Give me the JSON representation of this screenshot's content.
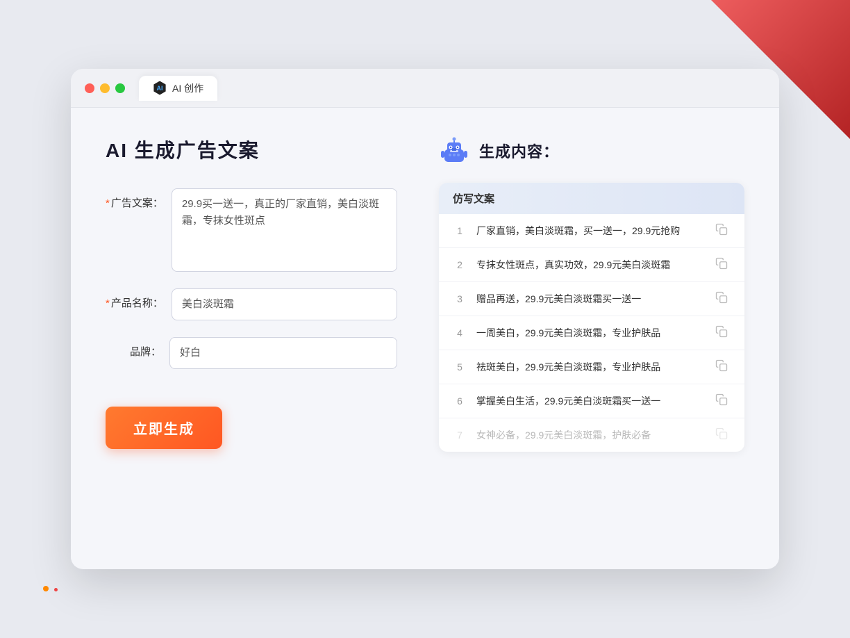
{
  "window": {
    "tab_label": "AI 创作",
    "tab_icon_text": "AI"
  },
  "page": {
    "title": "AI 生成广告文案",
    "result_title": "生成内容："
  },
  "form": {
    "ad_copy_label": "广告文案：",
    "ad_copy_required": "*",
    "ad_copy_value": "29.9买一送一，真正的厂家直销，美白淡斑霜，专抹女性斑点",
    "product_name_label": "产品名称：",
    "product_name_required": "*",
    "product_name_value": "美白淡斑霜",
    "brand_label": "品牌：",
    "brand_value": "好白",
    "generate_button": "立即生成"
  },
  "results": {
    "column_header": "仿写文案",
    "items": [
      {
        "num": 1,
        "text": "厂家直销，美白淡斑霜，买一送一，29.9元抢购"
      },
      {
        "num": 2,
        "text": "专抹女性斑点，真实功效，29.9元美白淡斑霜"
      },
      {
        "num": 3,
        "text": "赠品再送，29.9元美白淡斑霜买一送一"
      },
      {
        "num": 4,
        "text": "一周美白，29.9元美白淡斑霜，专业护肤品"
      },
      {
        "num": 5,
        "text": "祛斑美白，29.9元美白淡斑霜，专业护肤品"
      },
      {
        "num": 6,
        "text": "掌握美白生活，29.9元美白淡斑霜买一送一"
      },
      {
        "num": 7,
        "text": "女神必备，29.9元美白淡斑霜，护肤必备",
        "faded": true
      }
    ]
  }
}
